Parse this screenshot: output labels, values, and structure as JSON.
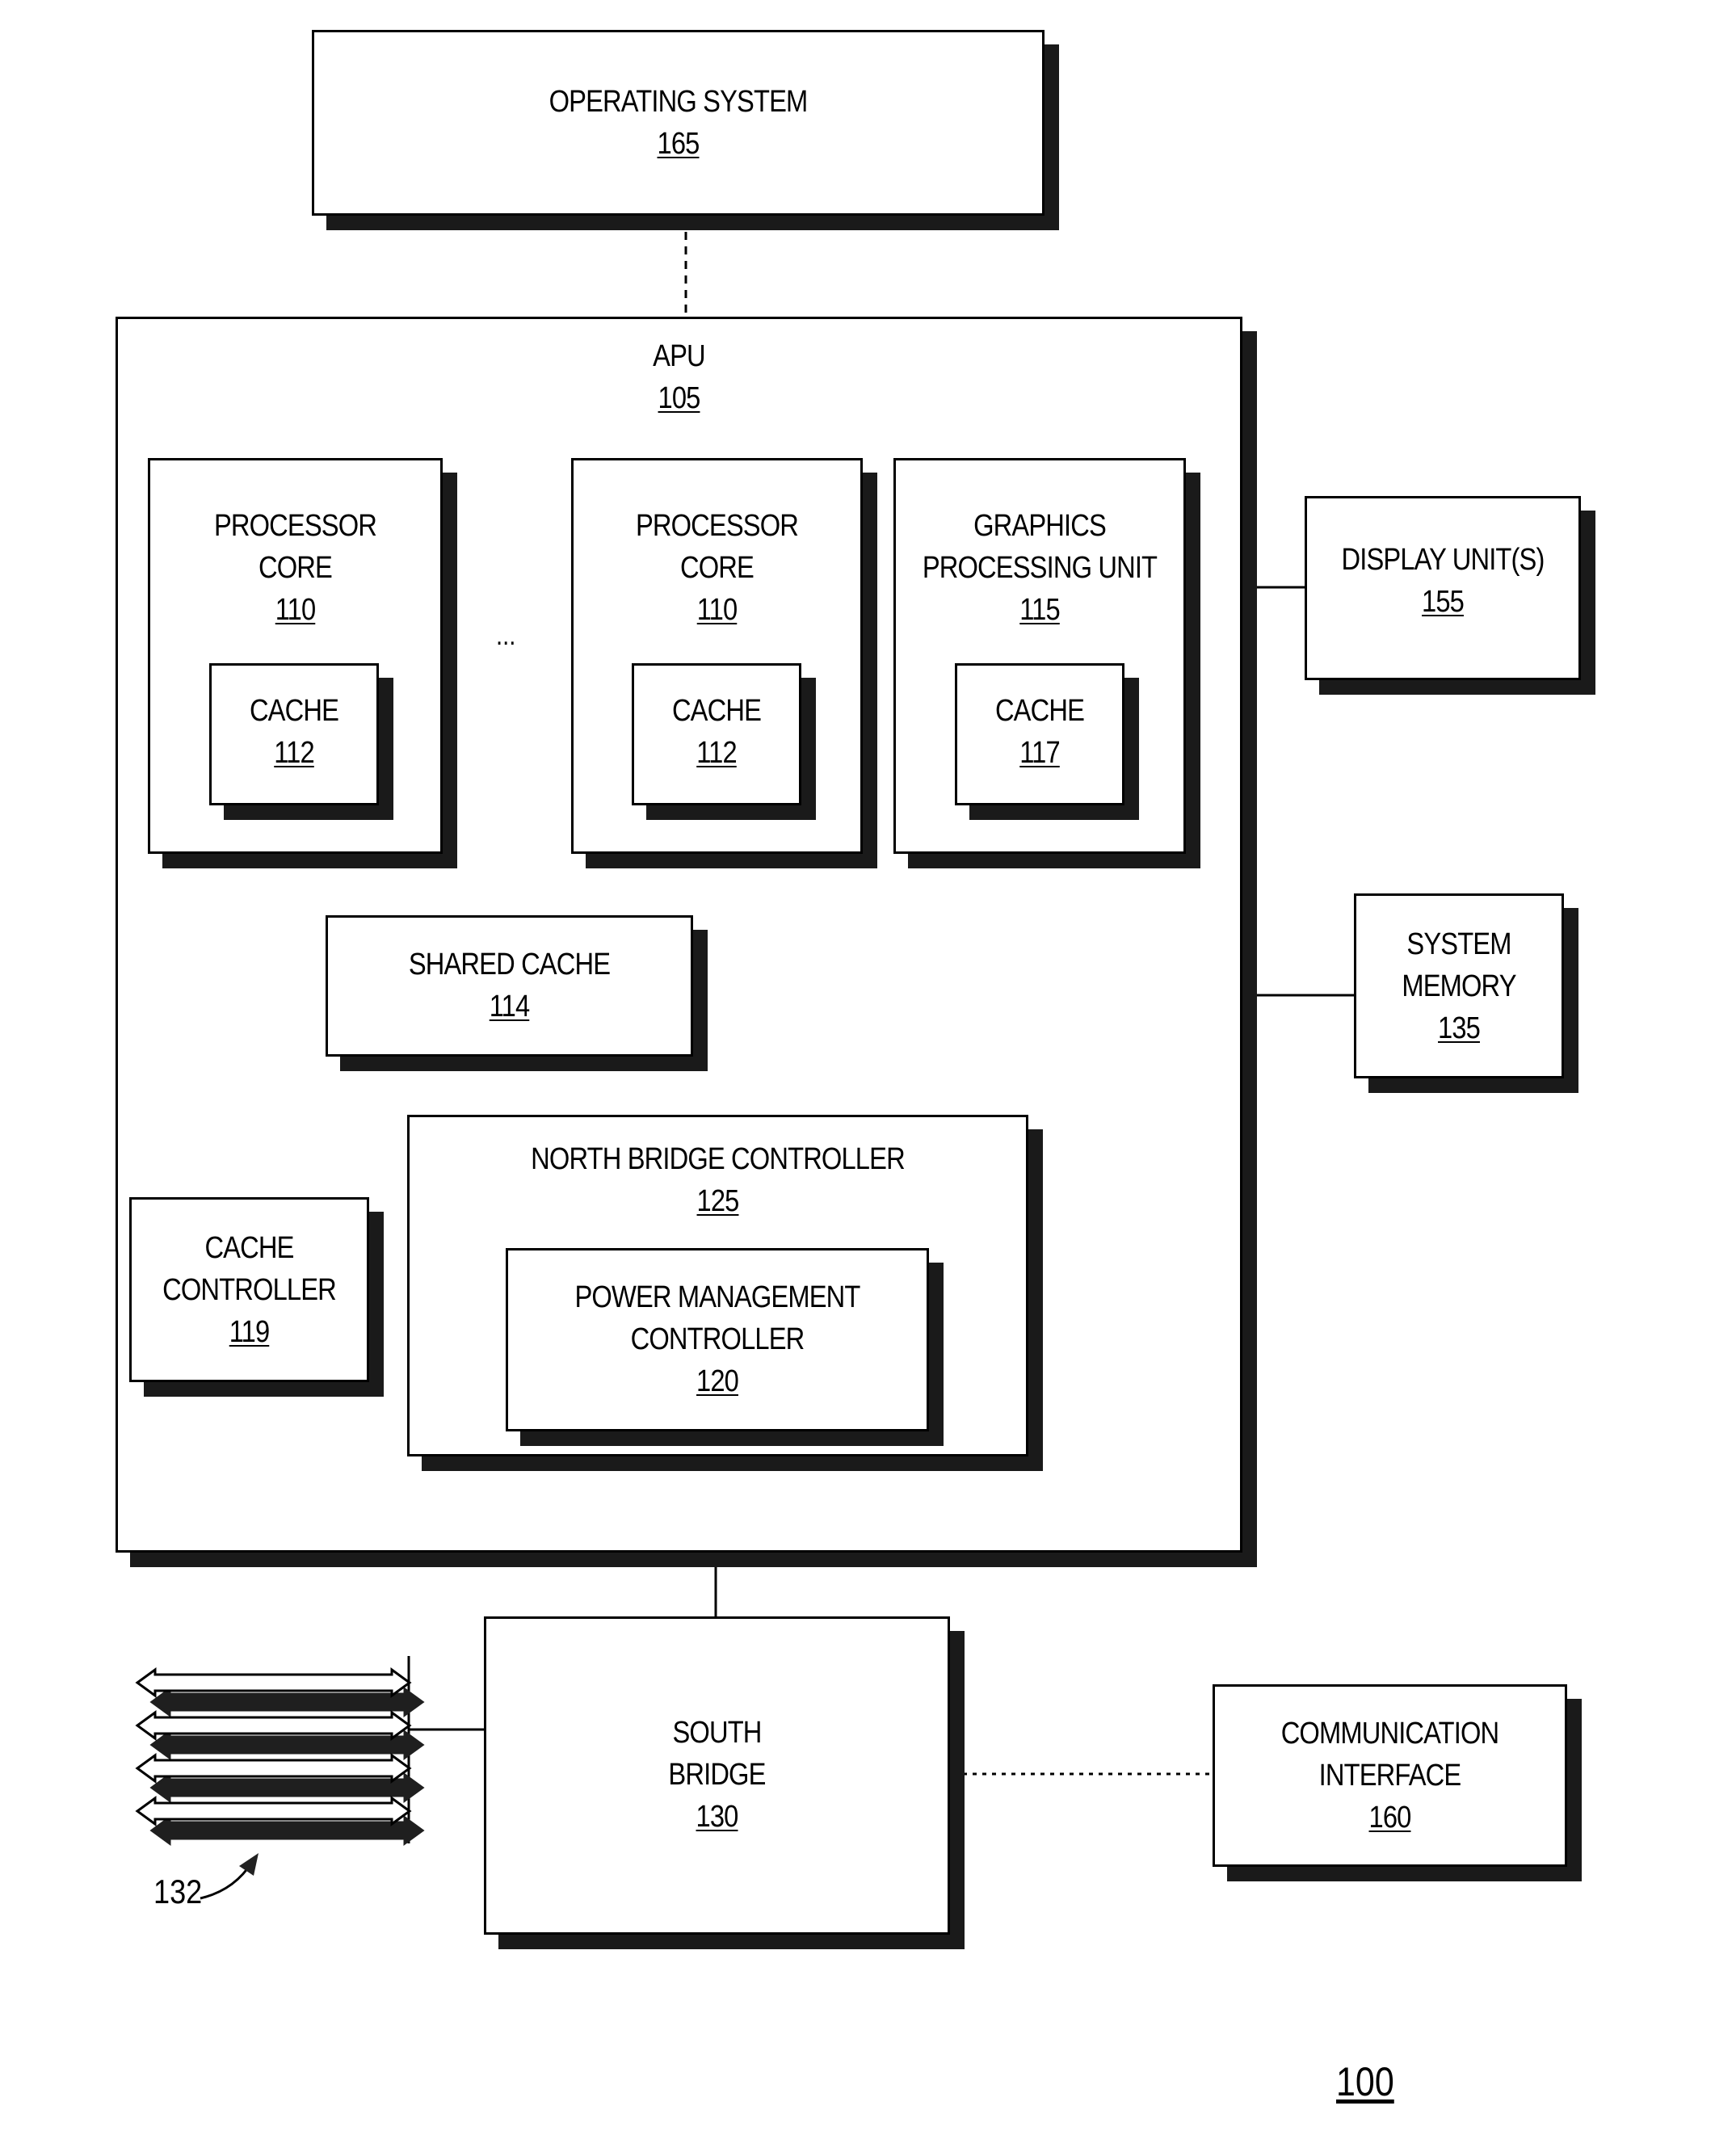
{
  "figure_number": "100",
  "blocks": {
    "operating_system": {
      "name": "OPERATING SYSTEM",
      "ref": "165"
    },
    "apu": {
      "name": "APU",
      "ref": "105"
    },
    "processor_core_1": {
      "name_lines": [
        "PROCESSOR",
        "CORE"
      ],
      "ref": "110"
    },
    "processor_core_2": {
      "name_lines": [
        "PROCESSOR",
        "CORE"
      ],
      "ref": "110"
    },
    "cache_1": {
      "name": "CACHE",
      "ref": "112"
    },
    "cache_2": {
      "name": "CACHE",
      "ref": "112"
    },
    "gpu": {
      "name_lines": [
        "GRAPHICS",
        "PROCESSING UNIT"
      ],
      "ref": "115"
    },
    "gpu_cache": {
      "name": "CACHE",
      "ref": "117"
    },
    "ellipsis": "...",
    "shared_cache": {
      "name": "SHARED CACHE",
      "ref": "114"
    },
    "cache_controller": {
      "name_lines": [
        "CACHE",
        "CONTROLLER"
      ],
      "ref": "119"
    },
    "north_bridge": {
      "name": "NORTH BRIDGE CONTROLLER",
      "ref": "125"
    },
    "power_management": {
      "name_lines": [
        "POWER MANAGEMENT",
        "CONTROLLER"
      ],
      "ref": "120"
    },
    "display_unit": {
      "name": "DISPLAY UNIT(S)",
      "ref": "155"
    },
    "system_memory": {
      "name_lines": [
        "SYSTEM",
        "MEMORY"
      ],
      "ref": "135"
    },
    "south_bridge": {
      "name_lines": [
        "SOUTH",
        "BRIDGE"
      ],
      "ref": "130"
    },
    "communication_interface": {
      "name_lines": [
        "COMMUNICATION",
        "INTERFACE"
      ],
      "ref": "160"
    },
    "buses": {
      "ref": "132",
      "count": 4
    }
  }
}
